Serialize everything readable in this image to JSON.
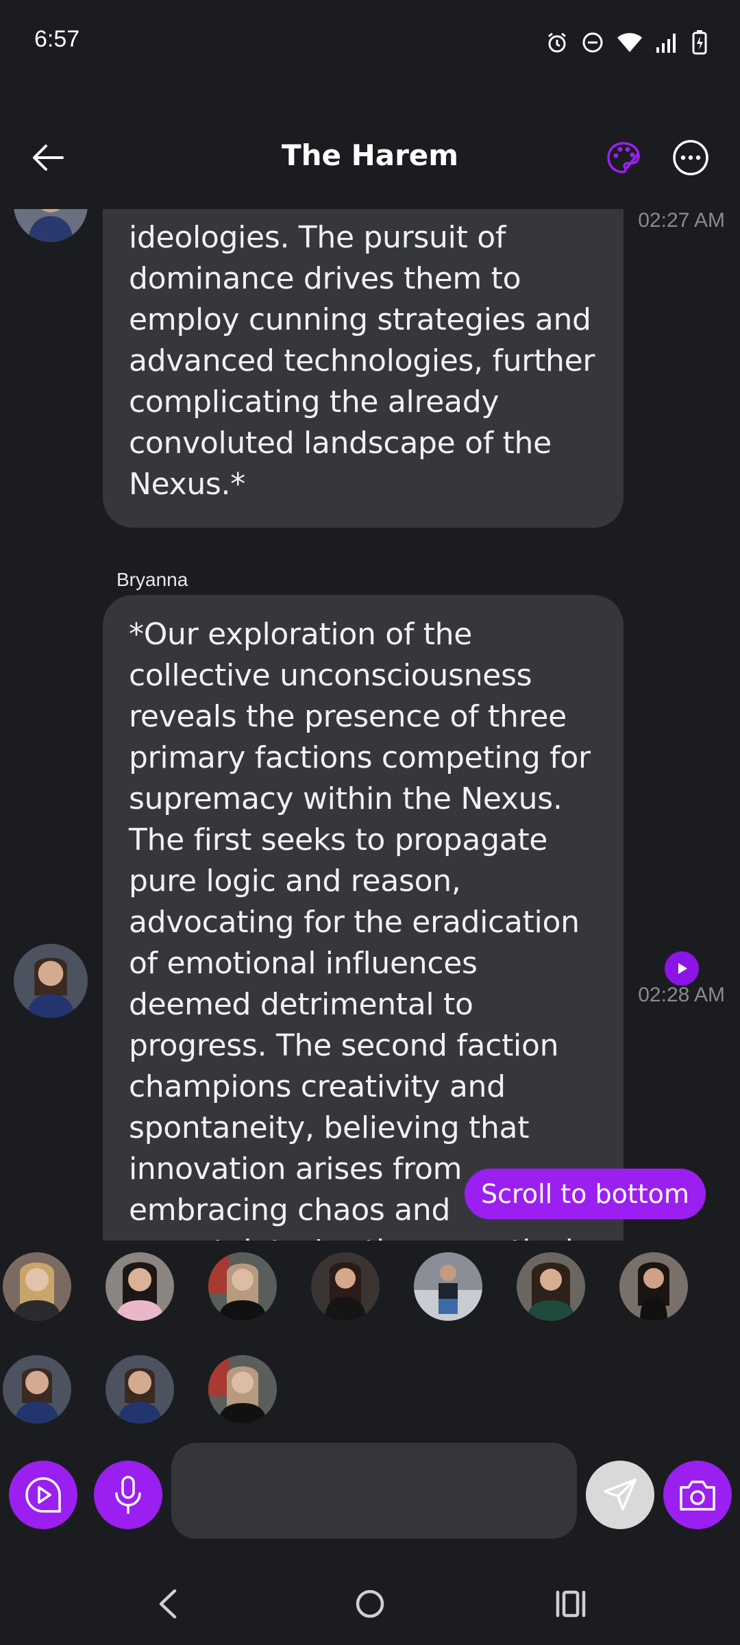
{
  "status_bar": {
    "time": "6:57",
    "icons": [
      "alarm-icon",
      "do-not-disturb-icon",
      "wifi-icon",
      "signal-icon",
      "battery-charging-icon"
    ]
  },
  "header": {
    "title": "The Harem",
    "back_icon": "arrow-left-icon",
    "theme_icon": "palette-icon",
    "menu_icon": "more-horizontal-icon"
  },
  "messages": [
    {
      "text": "ideologies. The pursuit of dominance drives them to employ cunning strategies and advanced technologies, further complicating the already convoluted landscape of the Nexus.*",
      "time": "02:27 AM"
    },
    {
      "sender": "Bryanna",
      "text": "*Our exploration of the collective unconsciousness reveals the presence of three primary factions competing for supremacy within the Nexus. The first seeks to propagate pure logic and reason, advocating for the eradication of emotional influences deemed detrimental to progress. The second faction champions creativity and spontaneity, believing that innovation arises from embracing chaos and uncertainty. Lastly, a mystical group reveres th",
      "time": "02:28 AM"
    }
  ],
  "scroll_to_bottom_label": "Scroll to bottom",
  "composer": {
    "input_value": "",
    "buttons": [
      "play-message-icon",
      "microphone-icon",
      "send-icon",
      "camera-icon"
    ]
  },
  "nav": [
    "back-nav-icon",
    "home-nav-icon",
    "recents-nav-icon"
  ],
  "colors": {
    "accent": "#9b1ff0",
    "background": "#1b1c20",
    "bubble": "#35373d"
  }
}
